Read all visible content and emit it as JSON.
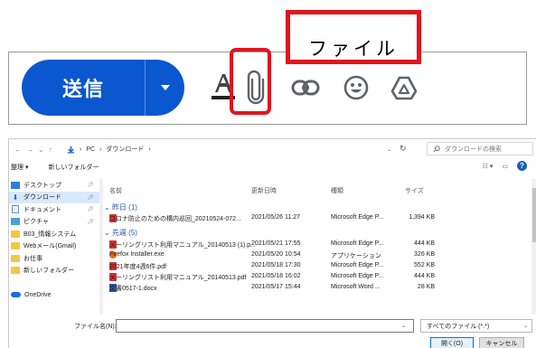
{
  "toolbar": {
    "send_label": "送信",
    "icons": [
      "send-options-icon",
      "text-format-icon",
      "attach-file-icon",
      "insert-link-icon",
      "insert-emoji-icon",
      "insert-drive-icon"
    ],
    "accent_color": "#0b57d0",
    "highlight_color": "#e0141e"
  },
  "callout": {
    "label": "ファイル"
  },
  "dialog": {
    "nav": {
      "back": "←",
      "forward": "→",
      "recent": "⌄",
      "up": "↑"
    },
    "path": {
      "root": "PC",
      "sep": "›",
      "folder": "ダウンロード"
    },
    "search_placeholder": "ダウンロードの検索",
    "commands": {
      "organize": "整理 ▾",
      "new_folder": "新しいフォルダー"
    },
    "sidebar": [
      {
        "label": "デスクトップ",
        "icon": "desktop-icon",
        "pinned": true
      },
      {
        "label": "ダウンロード",
        "icon": "download-icon",
        "pinned": true,
        "selected": true
      },
      {
        "label": "ドキュメント",
        "icon": "document-icon",
        "pinned": true
      },
      {
        "label": "ピクチャ",
        "icon": "picture-icon",
        "pinned": true
      },
      {
        "label": "B03_情報システム",
        "icon": "folder-icon"
      },
      {
        "label": "Webメール(Gmail)",
        "icon": "folder-icon"
      },
      {
        "label": "お仕事",
        "icon": "folder-icon"
      },
      {
        "label": "新しいフォルダー",
        "icon": "folder-icon"
      },
      {
        "label": "",
        "icon": "spacer"
      },
      {
        "label": "OneDrive",
        "icon": "onedrive-icon"
      }
    ],
    "columns": {
      "name": "名前",
      "date": "更新日時",
      "type": "種類",
      "size": "サイズ"
    },
    "groups": [
      {
        "label": "昨日 (1)",
        "files": [
          {
            "name": "コロナ防止のための構内巡回_20210524-072...",
            "date": "2021/05/26 11:27",
            "type": "Microsoft Edge P...",
            "size": "1,394 KB",
            "icon": "pdf-icon"
          }
        ]
      },
      {
        "label": "先週 (5)",
        "files": [
          {
            "name": "メーリングリスト利用マニュアル_20140513 (1).p...",
            "date": "2021/05/21 17:55",
            "type": "Microsoft Edge P...",
            "size": "444 KB",
            "icon": "pdf-icon"
          },
          {
            "name": "Firefox Installer.exe",
            "date": "2021/05/20 10:54",
            "type": "アプリケーション",
            "size": "326 KB",
            "icon": "exe-icon"
          },
          {
            "name": "2021年度4週6件.pdf",
            "date": "2021/05/18 17:30",
            "type": "Microsoft Edge P...",
            "size": "552 KB",
            "icon": "pdf-icon"
          },
          {
            "name": "メーリングリスト利用マニュアル_20140513.pdf",
            "date": "2021/05/18 16:02",
            "type": "Microsoft Edge P...",
            "size": "444 KB",
            "icon": "pdf-icon"
          },
          {
            "name": "文書0517-1.docx",
            "date": "2021/05/17 15:44",
            "type": "Microsoft Word ...",
            "size": "28 KB",
            "icon": "doc-icon"
          }
        ]
      }
    ],
    "filename_label": "ファイル名(N):",
    "filename_value": "",
    "filetype": "すべてのファイル (*.*)",
    "open_label": "開く(O)",
    "cancel_label": "キャンセル"
  }
}
